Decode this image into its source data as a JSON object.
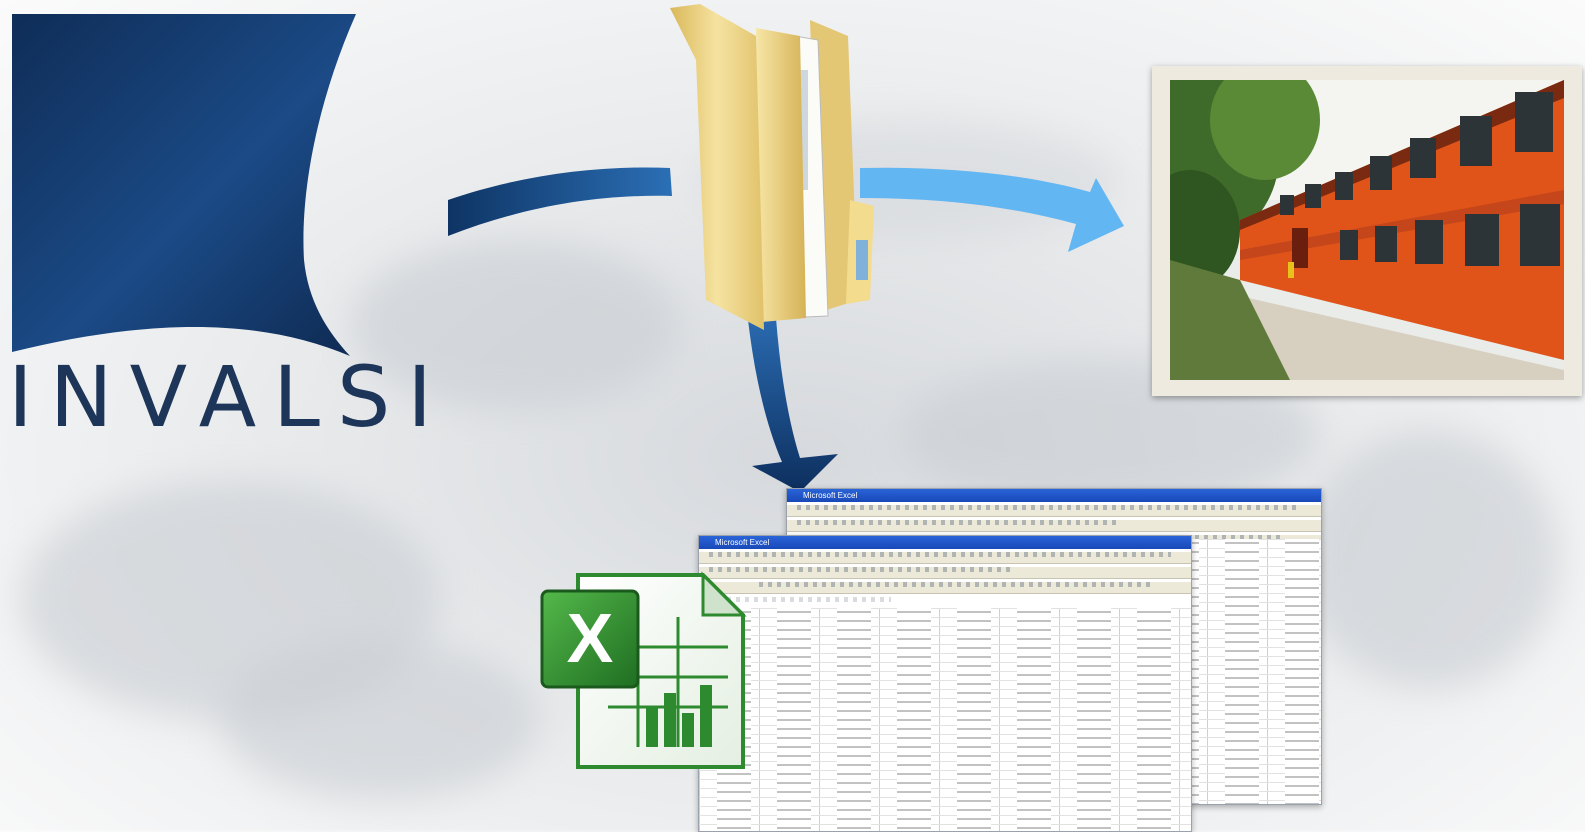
{
  "logo": {
    "text": "INVALSI",
    "colors": {
      "primary": "#0f2d57",
      "secondary": "#1f5a9e"
    }
  },
  "icons": {
    "folder": "folder-icon",
    "excel": "excel-icon",
    "photo": "school-building-photo",
    "spreadsheet": "spreadsheet-window"
  },
  "spreadsheets": [
    {
      "title": "Microsoft Excel"
    },
    {
      "title": "Microsoft Excel"
    }
  ],
  "colors": {
    "arrow_dark": "#0e3464",
    "arrow_light": "#62b6f2",
    "excel_green": "#2e8a2e"
  }
}
